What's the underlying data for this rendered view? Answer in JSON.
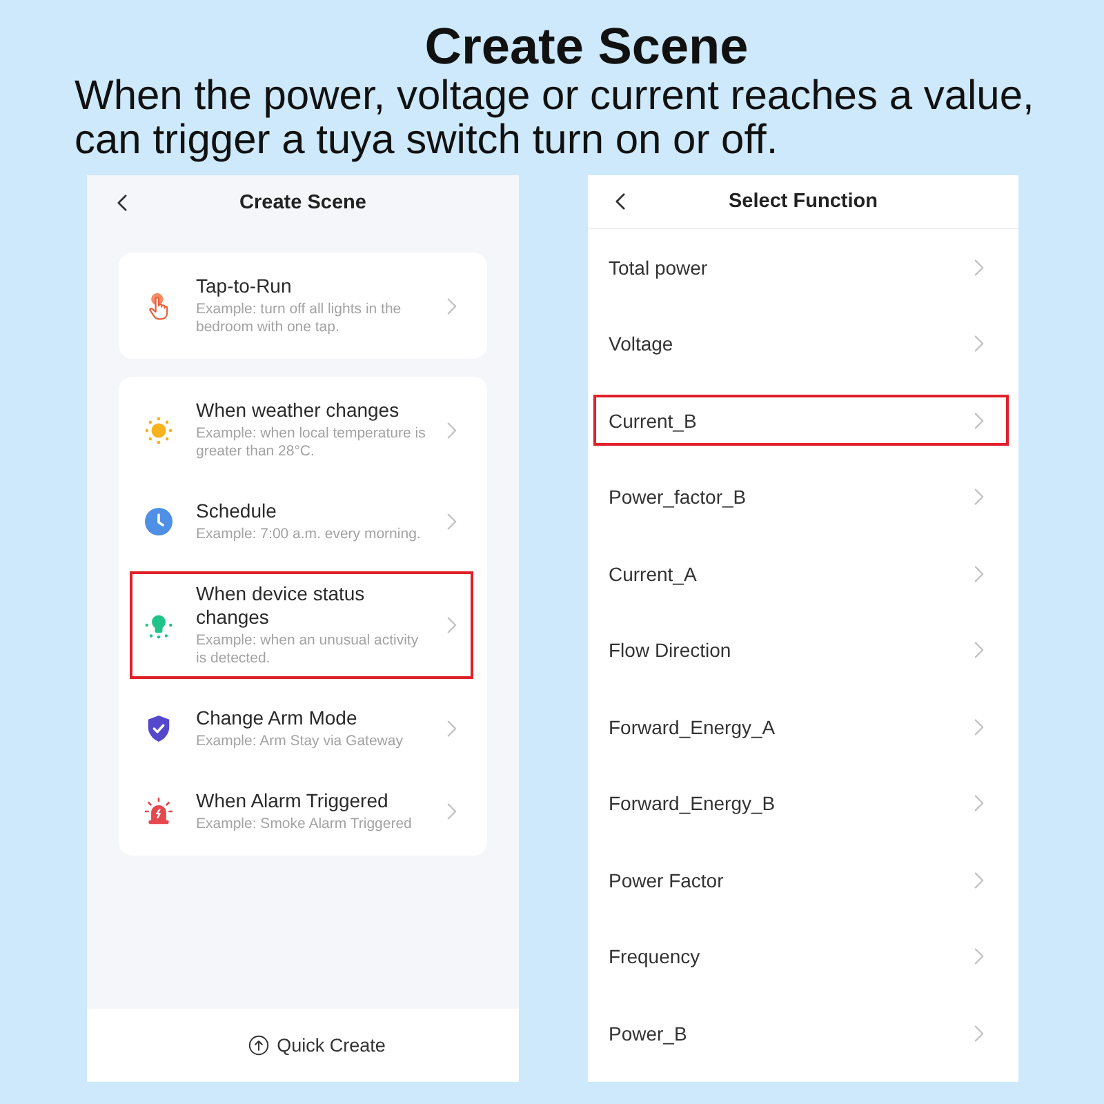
{
  "heading": {
    "title": "Create Scene",
    "description": "When the power, voltage or current reaches a value, can trigger a tuya switch turn on or off."
  },
  "create_scene_screen": {
    "title": "Create Scene",
    "groups": [
      {
        "items": [
          {
            "kind": "tap",
            "title": "Tap-to-Run",
            "example": "Example: turn off all lights in the bedroom with one tap.",
            "highlighted": false
          }
        ]
      },
      {
        "items": [
          {
            "kind": "weather",
            "title": "When weather changes",
            "example": "Example: when local temperature is greater than 28°C.",
            "highlighted": false
          },
          {
            "kind": "schedule",
            "title": "Schedule",
            "example": "Example: 7:00 a.m. every morning.",
            "highlighted": false
          },
          {
            "kind": "device",
            "title": "When device status changes",
            "example": "Example: when an unusual activity is detected.",
            "highlighted": true
          },
          {
            "kind": "arm",
            "title": "Change Arm Mode",
            "example": "Example: Arm Stay via Gateway",
            "highlighted": false
          },
          {
            "kind": "alarm",
            "title": "When Alarm Triggered",
            "example": "Example: Smoke Alarm Triggered",
            "highlighted": false
          }
        ]
      }
    ],
    "quick_create": "Quick Create"
  },
  "select_function_screen": {
    "title": "Select Function",
    "functions": [
      {
        "label": "Total power",
        "highlighted": false
      },
      {
        "label": "Voltage",
        "highlighted": false
      },
      {
        "label": "Current_B",
        "highlighted": true
      },
      {
        "label": "Power_factor_B",
        "highlighted": false
      },
      {
        "label": "Current_A",
        "highlighted": false
      },
      {
        "label": "Flow Direction",
        "highlighted": false
      },
      {
        "label": "Forward_Energy_A",
        "highlighted": false
      },
      {
        "label": "Forward_Energy_B",
        "highlighted": false
      },
      {
        "label": "Power Factor",
        "highlighted": false
      },
      {
        "label": "Frequency",
        "highlighted": false
      },
      {
        "label": "Power_B",
        "highlighted": false
      }
    ]
  }
}
